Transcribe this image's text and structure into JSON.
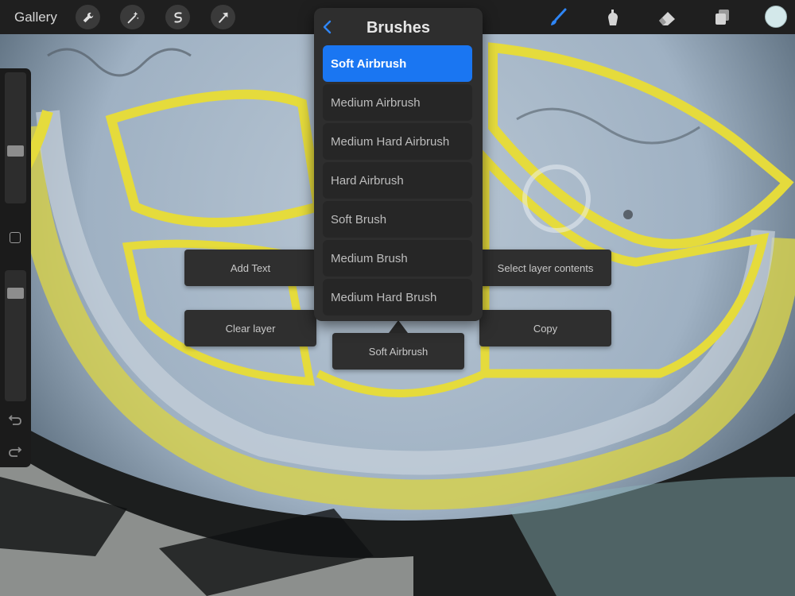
{
  "topbar": {
    "gallery_label": "Gallery",
    "left_tools": [
      "wrench-icon",
      "magic-wand-icon",
      "selection-icon",
      "transform-icon"
    ],
    "right_tools": [
      "brush-icon",
      "smudge-icon",
      "eraser-icon",
      "layers-icon",
      "color-icon"
    ],
    "active_tool_color": "#2f86f6",
    "current_color": "#d3e8ea"
  },
  "sidebar": {
    "brush_size_fraction": 0.2,
    "opacity_fraction": 0.15
  },
  "brushes": {
    "title": "Brushes",
    "selected_color": "#1a76f2",
    "items": [
      {
        "label": "Soft Airbrush",
        "selected": true
      },
      {
        "label": "Medium Airbrush",
        "selected": false
      },
      {
        "label": "Medium Hard Airbrush",
        "selected": false
      },
      {
        "label": "Hard Airbrush",
        "selected": false
      },
      {
        "label": "Soft Brush",
        "selected": false
      },
      {
        "label": "Medium Brush",
        "selected": false
      },
      {
        "label": "Medium Hard Brush",
        "selected": false
      }
    ]
  },
  "quick_menu": {
    "add_text": "Add Text",
    "select_layer_contents": "Select layer contents",
    "clear_layer": "Clear layer",
    "copy": "Copy",
    "current_brush": "Soft Airbrush"
  }
}
